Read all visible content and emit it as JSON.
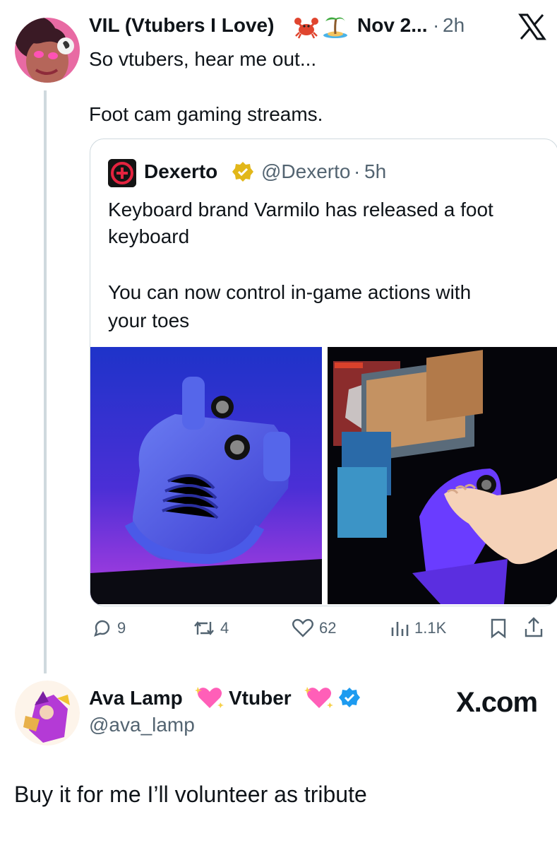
{
  "main_tweet": {
    "author_name": "VIL (Vtubers I Love)",
    "author_emojis": [
      "crab-icon",
      "island-icon"
    ],
    "date": "Nov 2...",
    "separator": "·",
    "time_ago": "2h",
    "text_line1": "So vtubers, hear me out...",
    "text_line2": "Foot cam gaming streams."
  },
  "quoted_tweet": {
    "author_name": "Dexerto",
    "handle": "@Dexerto",
    "separator": "·",
    "time_ago": "5h",
    "text_line1": "Keyboard brand Varmilo has released a foot",
    "text_line2": "keyboard",
    "text_line3": "You can now control in-game actions with",
    "text_line4": "your toes",
    "verified_color": "#e2b719"
  },
  "actions": {
    "replies": "9",
    "reposts": "4",
    "likes": "62",
    "views": "1.1K"
  },
  "reply_tweet": {
    "author_name_part1": "Ava Lamp",
    "author_name_part2": "Vtuber",
    "handle": "@ava_lamp",
    "text": "Buy it for me I’ll volunteer as tribute",
    "verified_color": "#1d9bf0"
  },
  "branding": {
    "x_com": "X.com"
  },
  "colors": {
    "accent_blue": "#1d9bf0",
    "muted_text": "#536471",
    "border": "#cfd9de"
  }
}
